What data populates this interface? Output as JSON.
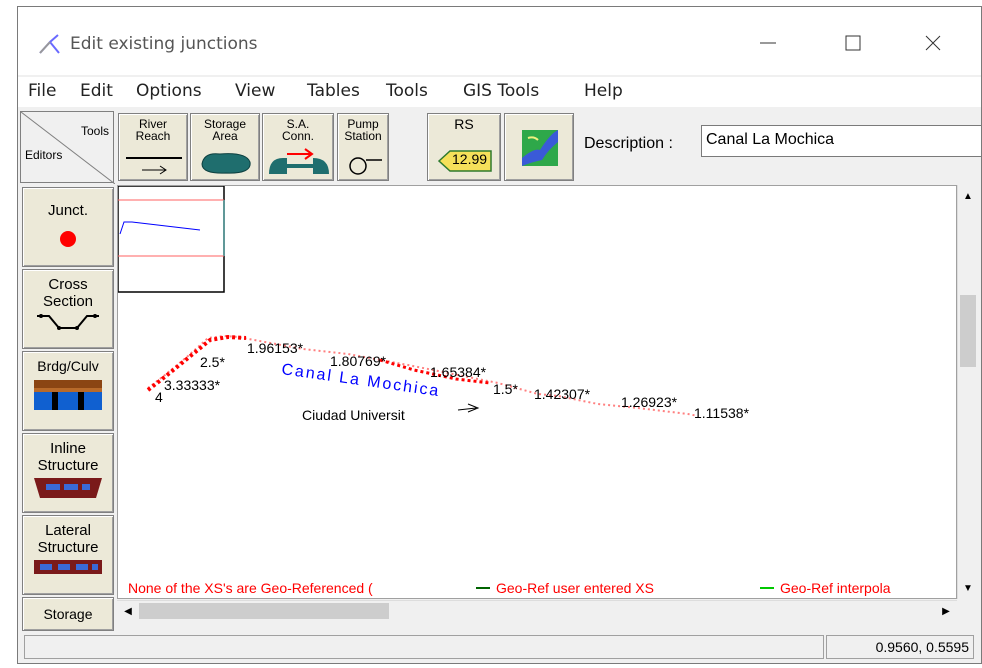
{
  "window": {
    "title": "Edit existing junctions",
    "controls": {
      "minimize": "minimize-icon",
      "maximize": "maximize-icon",
      "close": "close-icon"
    }
  },
  "menu": [
    "File",
    "Edit",
    "Options",
    "View",
    "Tables",
    "Tools",
    "GIS Tools",
    "Help"
  ],
  "toolbar": {
    "corner_top": "Tools",
    "corner_bottom": "Editors",
    "river_reach": "River\nReach",
    "storage_area": "Storage\nArea",
    "sa_conn": "S.A.\nConn.",
    "pump_station": "Pump\nStation",
    "rs": "RS",
    "rs_value": "12.99",
    "description_label": "Description :",
    "description_value": "Canal La Mochica"
  },
  "editors": {
    "junct": "Junct.",
    "cross_section": "Cross\nSection",
    "brdg_culv": "Brdg/Culv",
    "inline_structure": "Inline\nStructure",
    "lateral_structure": "Lateral\nStructure",
    "storage": "Storage"
  },
  "canvas": {
    "reach_name": "Canal La Mochica",
    "junction_label": "Ciudad Universit",
    "river_stations": [
      "4",
      "3.33333*",
      "2.5*",
      "1.96153*",
      "1.80769*",
      "1.65384*",
      "1.5*",
      "1.42307*",
      "1.26923*",
      "1.11538*"
    ],
    "legend_red": "None of the XS's are Geo-Referenced (",
    "legend_dark_green": "Geo-Ref user entered XS",
    "legend_light_green": "Geo-Ref interpola",
    "colors": {
      "reach": "#0000ff",
      "xs": "#ff0000",
      "legend_dark_green": "#006400",
      "legend_light_green": "#00c800"
    }
  },
  "status": {
    "coords": "0.9560, 0.5595"
  }
}
